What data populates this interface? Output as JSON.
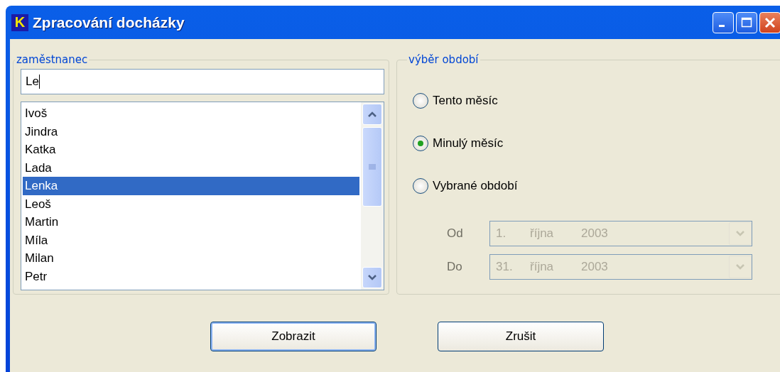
{
  "window": {
    "title": "Zpracování docházky",
    "app_icon": "K"
  },
  "employee": {
    "legend": "zaměstnanec",
    "search_value": "Le",
    "list": [
      {
        "name": "Ivoš",
        "selected": false
      },
      {
        "name": "Jindra",
        "selected": false
      },
      {
        "name": "Katka",
        "selected": false
      },
      {
        "name": "Lada",
        "selected": false
      },
      {
        "name": "Lenka",
        "selected": true
      },
      {
        "name": "Leoš",
        "selected": false
      },
      {
        "name": "Martin",
        "selected": false
      },
      {
        "name": "Míla",
        "selected": false
      },
      {
        "name": "Milan",
        "selected": false
      },
      {
        "name": "Petr",
        "selected": false
      }
    ]
  },
  "period": {
    "legend": "výběr období",
    "options": [
      {
        "label": "Tento měsíc",
        "selected": false
      },
      {
        "label": "Minulý měsíc",
        "selected": true
      },
      {
        "label": "Vybrané období",
        "selected": false
      }
    ],
    "dates": [
      {
        "label": "Od",
        "day": "1.",
        "month": "října",
        "year": "2003",
        "disabled": true
      },
      {
        "label": "Do",
        "day": "31.",
        "month": "října",
        "year": "2003",
        "disabled": true
      }
    ]
  },
  "buttons": [
    {
      "label": "Zobrazit",
      "default": true
    },
    {
      "label": "Zrušit",
      "default": false
    }
  ]
}
